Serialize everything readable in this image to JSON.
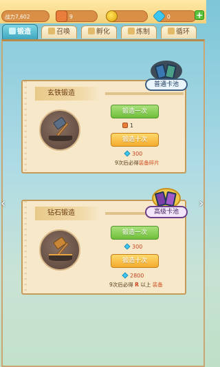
{
  "resources": {
    "power": "战力7,602",
    "scrolls": "9",
    "coins": "",
    "gems": "0",
    "plus_label": "+"
  },
  "tabs": [
    {
      "label": "锻造"
    },
    {
      "label": "召唤"
    },
    {
      "label": "孵化"
    },
    {
      "label": "炼制"
    },
    {
      "label": "循环"
    }
  ],
  "cards": [
    {
      "title": "玄铁锻造",
      "pool_label": "普通卡池",
      "btn_once": "锻造一次",
      "cost_once": "1",
      "btn_ten": "锻造十次",
      "cost_ten": "300",
      "note_prefix": "9次后必得",
      "note_highlight": "装备碎片"
    },
    {
      "title": "钻石锻造",
      "pool_label": "高级卡池",
      "btn_once": "锻造一次",
      "cost_once": "300",
      "btn_ten": "锻造十次",
      "cost_ten": "2800",
      "note_prefix": "9次后必得",
      "note_mid": "R",
      "note_mid2": "以上",
      "note_highlight": "装备"
    }
  ],
  "nav": {
    "left": "‹",
    "right": "›"
  }
}
